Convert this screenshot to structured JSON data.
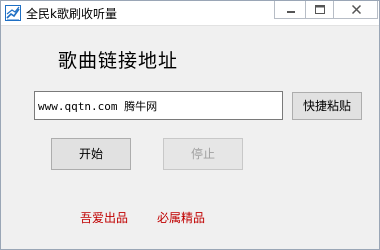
{
  "window": {
    "title": "全民k歌刷收听量",
    "icons": {
      "app": "app-icon",
      "minimize": "minimize-icon",
      "maximize": "maximize-icon",
      "close": "close-icon"
    }
  },
  "main": {
    "heading": "歌曲链接地址",
    "url_value": "www.qqtn.com 腾牛网",
    "paste_label": "快捷粘贴",
    "start_label": "开始",
    "stop_label": "停止",
    "stop_enabled": false
  },
  "footer": {
    "link1": "吾爱出品",
    "link2": "必属精品",
    "link_color": "#c00000"
  },
  "colors": {
    "window_bg": "#f0f0f0",
    "titlebar_bg": "#ffffff",
    "app_icon": "#1e6fc4"
  }
}
